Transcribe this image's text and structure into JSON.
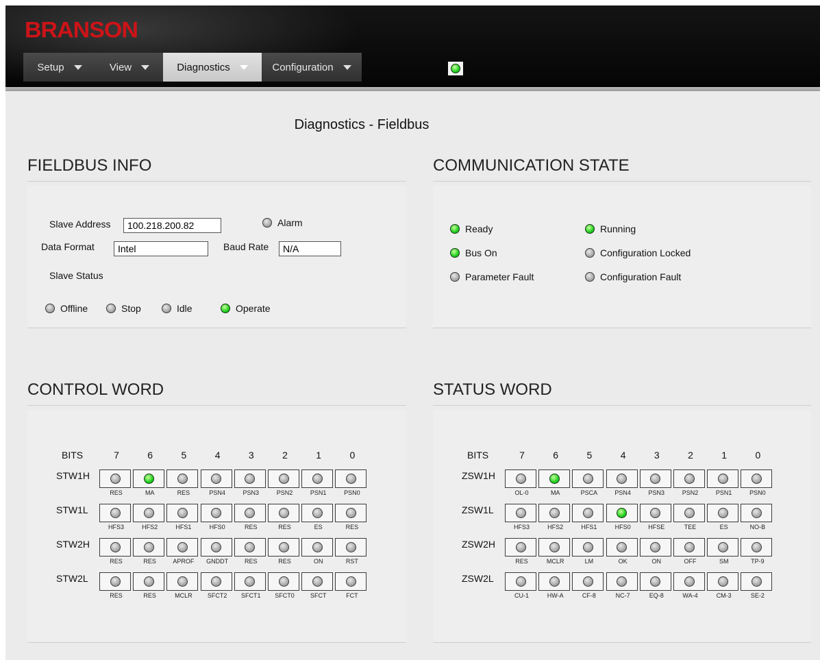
{
  "app": {
    "logo": "BRANSON",
    "status_led": "on"
  },
  "menu": [
    {
      "label": "Setup",
      "caret": true,
      "active": false,
      "width": 106
    },
    {
      "label": "View",
      "caret": true,
      "active": false,
      "width": 98
    },
    {
      "label": "Diagnostics",
      "caret": true,
      "active": true,
      "width": 144
    },
    {
      "label": "Configuration",
      "caret": true,
      "active": false,
      "width": 146
    }
  ],
  "page": {
    "title": "Diagnostics - Fieldbus"
  },
  "fieldbus_info": {
    "title": "FIELDBUS INFO",
    "slave_address_label": "Slave Address",
    "slave_address_value": "100.218.200.82",
    "alarm_label": "Alarm",
    "alarm_on": false,
    "data_format_label": "Data Format",
    "data_format_value": "Intel",
    "baud_rate_label": "Baud Rate",
    "baud_rate_value": "N/A",
    "slave_status_label": "Slave Status",
    "slave_status": [
      {
        "label": "Offline",
        "on": false
      },
      {
        "label": "Stop",
        "on": false
      },
      {
        "label": "Idle",
        "on": false
      },
      {
        "label": "Operate",
        "on": true
      }
    ]
  },
  "communication_state": {
    "title": "COMMUNICATION STATE",
    "items": [
      {
        "label": "Ready",
        "on": true
      },
      {
        "label": "Running",
        "on": true
      },
      {
        "label": "Bus On",
        "on": true
      },
      {
        "label": "Configuration Locked",
        "on": false
      },
      {
        "label": "Parameter Fault",
        "on": false
      },
      {
        "label": "Configuration Fault",
        "on": false
      }
    ]
  },
  "control_word": {
    "title": "CONTROL WORD",
    "bits_label": "BITS",
    "bits": [
      "7",
      "6",
      "5",
      "4",
      "3",
      "2",
      "1",
      "0"
    ],
    "rows": [
      {
        "name": "STW1H",
        "labels": [
          "RES",
          "MA",
          "RES",
          "PSN4",
          "PSN3",
          "PSN2",
          "PSN1",
          "PSN0"
        ],
        "states": [
          0,
          1,
          0,
          0,
          0,
          0,
          0,
          0
        ]
      },
      {
        "name": "STW1L",
        "labels": [
          "HFS3",
          "HFS2",
          "HFS1",
          "HFS0",
          "RES",
          "RES",
          "ES",
          "RES"
        ],
        "states": [
          0,
          0,
          0,
          0,
          0,
          0,
          0,
          0
        ]
      },
      {
        "name": "STW2H",
        "labels": [
          "RES",
          "RES",
          "APROF",
          "GNDDT",
          "RES",
          "RES",
          "ON",
          "RST"
        ],
        "states": [
          0,
          0,
          0,
          0,
          0,
          0,
          0,
          0
        ]
      },
      {
        "name": "STW2L",
        "labels": [
          "RES",
          "RES",
          "MCLR",
          "SFCT2",
          "SFCT1",
          "SFCT0",
          "SFCT",
          "FCT"
        ],
        "states": [
          0,
          0,
          0,
          0,
          0,
          0,
          0,
          0
        ]
      }
    ]
  },
  "status_word": {
    "title": "STATUS WORD",
    "bits_label": "BITS",
    "bits": [
      "7",
      "6",
      "5",
      "4",
      "3",
      "2",
      "1",
      "0"
    ],
    "rows": [
      {
        "name": "ZSW1H",
        "labels": [
          "OL-0",
          "MA",
          "PSCA",
          "PSN4",
          "PSN3",
          "PSN2",
          "PSN1",
          "PSN0"
        ],
        "states": [
          0,
          1,
          0,
          0,
          0,
          0,
          0,
          0
        ]
      },
      {
        "name": "ZSW1L",
        "labels": [
          "HFS3",
          "HFS2",
          "HFS1",
          "HFS0",
          "HFSE",
          "TEE",
          "ES",
          "NO-B"
        ],
        "states": [
          0,
          0,
          0,
          1,
          0,
          0,
          0,
          0
        ]
      },
      {
        "name": "ZSW2H",
        "labels": [
          "RES",
          "MCLR",
          "LM",
          "OK",
          "ON",
          "OFF",
          "SM",
          "TP-9"
        ],
        "states": [
          0,
          0,
          0,
          0,
          0,
          0,
          0,
          0
        ]
      },
      {
        "name": "ZSW2L",
        "labels": [
          "CU-1",
          "HW-A",
          "CF-8",
          "NC-7",
          "EQ-8",
          "WA-4",
          "CM-3",
          "SE-2"
        ],
        "states": [
          0,
          0,
          0,
          0,
          0,
          0,
          0,
          0
        ]
      }
    ]
  }
}
